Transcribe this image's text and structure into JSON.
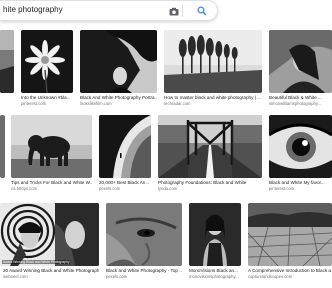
{
  "search": {
    "query": "hite photography"
  },
  "icons": {
    "camera": "camera-icon",
    "search": "search-icon"
  },
  "colors": {
    "accent": "#4285f4",
    "label": "#202124",
    "source": "#70757a"
  },
  "results": [
    {
      "title": "",
      "source": ""
    },
    {
      "title": "Into the Unknown #bla...",
      "source": "pinterest.com"
    },
    {
      "title": "Black And White Photography Portra...",
      "source": "lookslikefilm.com"
    },
    {
      "title": "How to master black and white photography | ...",
      "source": "techradar.com"
    },
    {
      "title": "Beautiful Black & White ...",
      "source": "simonwilliamsphotography..."
    },
    {
      "title": "",
      "source": ""
    },
    {
      "title": "Tips and Tricks For Black and White W...",
      "source": "ca.500px.com"
    },
    {
      "title": "20,000+ Best Black An...",
      "source": "pexels.com"
    },
    {
      "title": "Photography Foundations: Black and White",
      "source": "lynda.com"
    },
    {
      "title": "Black and White My favor...",
      "source": "pinterest.com"
    },
    {
      "title": "20 Award Winning Black and White Photographs ...",
      "source": "webneel.com",
      "caption": "Award Winning Black and White Photography"
    },
    {
      "title": "Black and White Photography - Top ...",
      "source": "pexels.com"
    },
    {
      "title": "MonoVisions Black an...",
      "source": "monovisionsphotography..."
    },
    {
      "title": "A Comprehensive Introduction to Black a...",
      "source": "capturelandscapes.com"
    }
  ]
}
